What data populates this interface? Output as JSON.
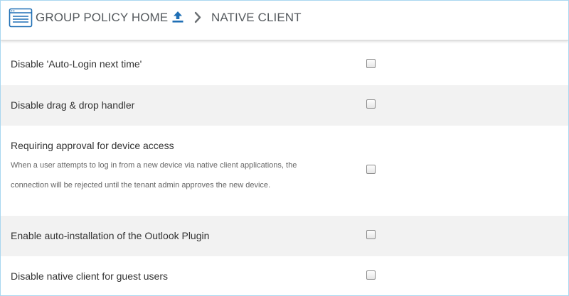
{
  "header": {
    "home_label": "GROUP POLICY HOME",
    "current_label": "NATIVE CLIENT"
  },
  "colors": {
    "accent": "#1f6fb5",
    "border": "#a9d7f0",
    "alt_row": "#f2f2f2"
  },
  "settings": [
    {
      "label": "Disable 'Auto-Login next time'",
      "description": "",
      "checked": false
    },
    {
      "label": "Disable drag & drop handler",
      "description": "",
      "checked": false
    },
    {
      "label": "Requiring approval for device access",
      "description_line1": "When a user attempts to log in from a new device via native client applications, the",
      "description_line2": "connection will be rejected until the tenant admin approves the new device.",
      "checked": false
    },
    {
      "label": "Enable auto-installation of the Outlook Plugin",
      "description": "",
      "checked": false
    },
    {
      "label": "Disable native client for guest users",
      "description": "",
      "checked": false
    }
  ]
}
